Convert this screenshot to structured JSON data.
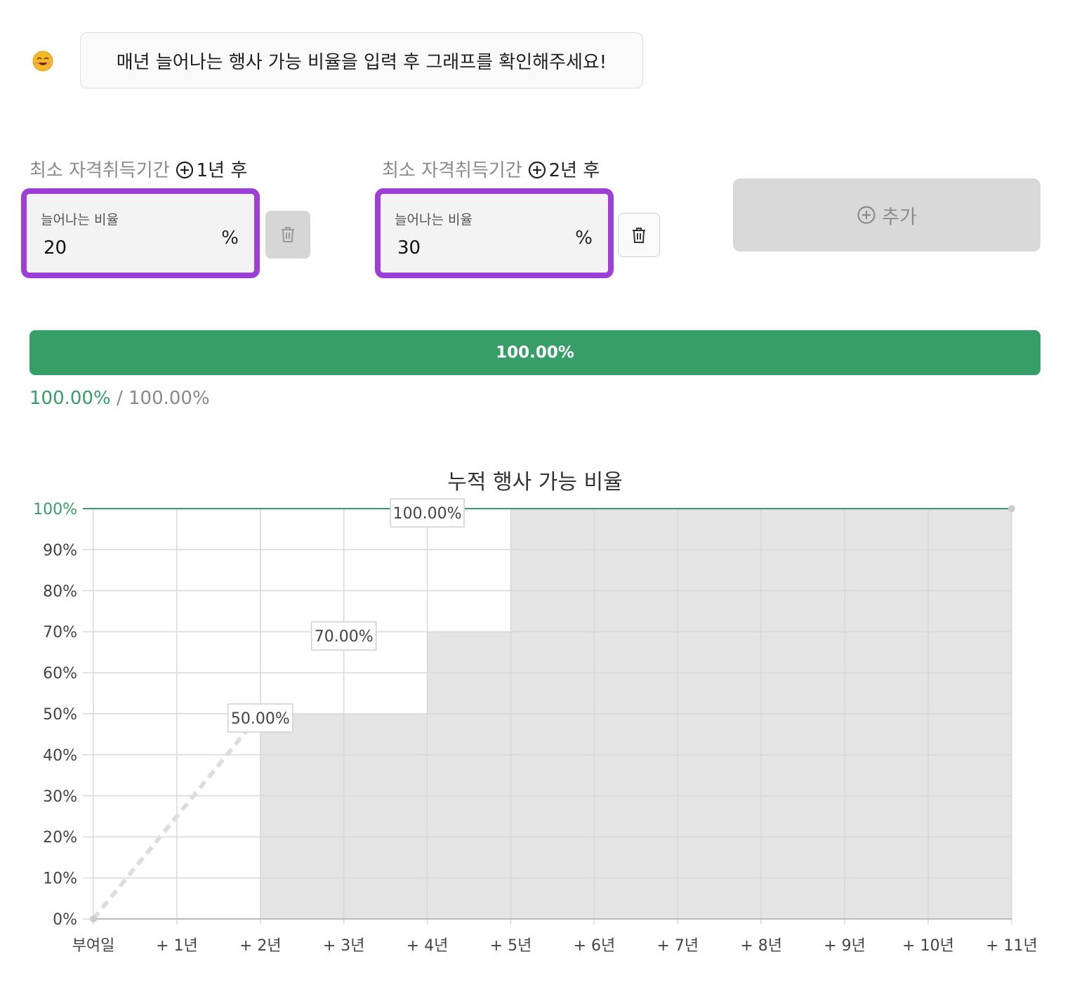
{
  "guide": {
    "emoji": "smiling-face-icon",
    "text": "매년 늘어나는 행사 가능 비율을 입력 후 그래프를 확인해주세요!"
  },
  "conditions": [
    {
      "label_prefix": "최소 자격취득기간",
      "label_suffix": "1년 후",
      "field_label": "늘어나는 비율",
      "value": "20",
      "unit": "%",
      "delete_enabled": false
    },
    {
      "label_prefix": "최소 자격취득기간",
      "label_suffix": "2년 후",
      "field_label": "늘어나는 비율",
      "value": "30",
      "unit": "%",
      "delete_enabled": true
    }
  ],
  "add_button": {
    "label": "추가"
  },
  "progress": {
    "fraction": 1.0,
    "label": "100.00%",
    "current": "100.00%",
    "separator": "/",
    "total": "100.00%"
  },
  "colors": {
    "accent_green": "#389e67",
    "highlight_purple": "#9b3fd5",
    "step_fill": "#e4e4e4"
  },
  "chart_data": {
    "type": "area",
    "title": "누적 행사 가능 비율",
    "categories": [
      "부여일",
      "+ 1년",
      "+ 2년",
      "+ 3년",
      "+ 4년",
      "+ 5년",
      "+ 6년",
      "+ 7년",
      "+ 8년",
      "+ 9년",
      "+ 10년",
      "+ 11년"
    ],
    "series": [
      {
        "values": [
          0,
          null,
          50,
          50,
          70,
          100,
          100,
          100,
          100,
          100,
          100,
          100
        ],
        "step": true
      },
      {
        "values": [
          0,
          25,
          50
        ],
        "dashed": true
      }
    ],
    "data_labels": [
      {
        "x": "+ 2년",
        "y": 50,
        "text": "50.00%"
      },
      {
        "x": "+ 3년",
        "y": 70,
        "text": "70.00%"
      },
      {
        "x": "+ 4년",
        "y": 100,
        "text": "100.00%"
      }
    ],
    "y_ticks": [
      "0%",
      "10%",
      "20%",
      "30%",
      "40%",
      "50%",
      "60%",
      "70%",
      "80%",
      "90%",
      "100%"
    ],
    "ylim": [
      0,
      100
    ],
    "reference_line": {
      "y": 100,
      "label": "100%"
    },
    "grid": true,
    "legend": "none"
  }
}
